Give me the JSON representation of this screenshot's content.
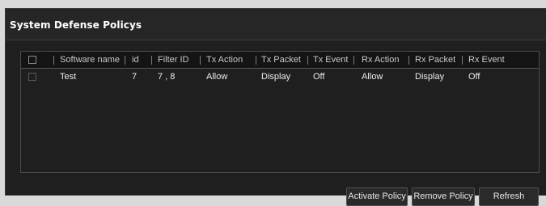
{
  "panel": {
    "title": "System Defense Policys"
  },
  "table": {
    "columns": [
      "Software name",
      "id",
      "Filter ID",
      "Tx Action",
      "Tx Packet",
      "Tx Event",
      "Rx Action",
      "Rx Packet",
      "Rx Event"
    ],
    "rows": [
      [
        "Test",
        "7",
        "7 , 8",
        "Allow",
        "Display",
        "Off",
        "Allow",
        "Display",
        "Off"
      ]
    ]
  },
  "buttons": {
    "activate": "Activate Policy",
    "remove": "Remove Policy",
    "refresh": "Refresh"
  },
  "colors": {
    "panel_bg": "#1f1f1f",
    "header_row_bg": "#141414",
    "text": "#ececec",
    "page_bg": "#d9d9d9"
  }
}
